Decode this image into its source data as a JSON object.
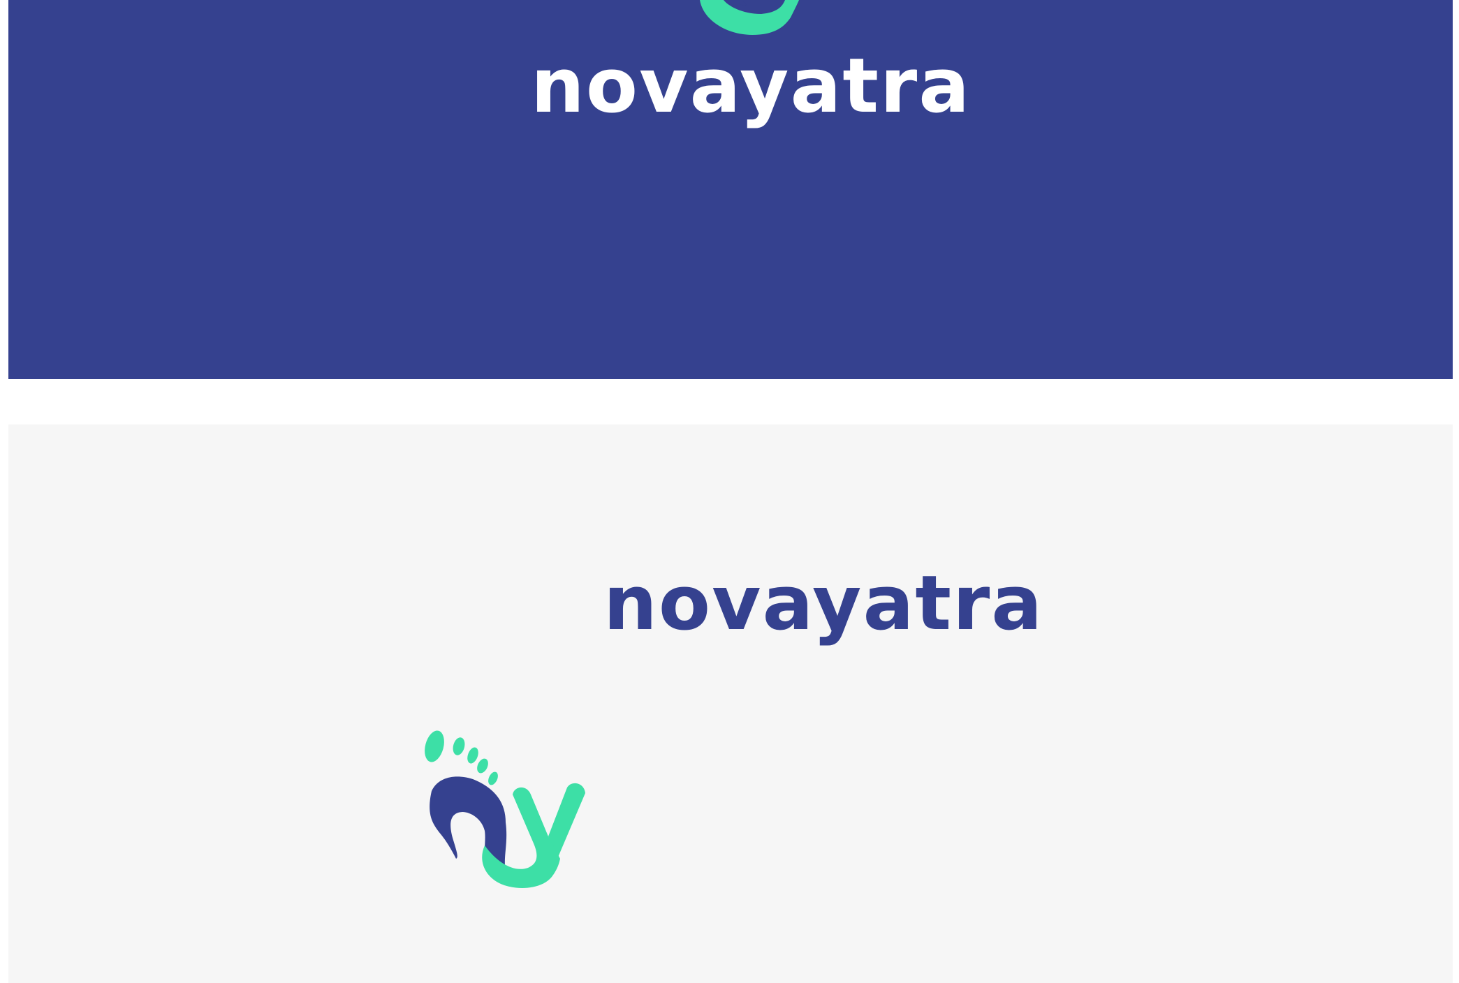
{
  "brand": {
    "name": "novayatra",
    "primary_color": "#35418f",
    "accent_color": "#3ddfa6",
    "light_color": "#ffffff",
    "background_light": "#f6f6f6"
  },
  "top_panel": {
    "background": "#35418f",
    "wordmark_color": "#ffffff",
    "symbol_color": "#3ddfa6"
  },
  "bottom_panel": {
    "background": "#f6f6f6",
    "wordmark_color": "#35418f",
    "symbol_colors": [
      "#35418f",
      "#3ddfa6"
    ],
    "icon": "footprint-y-icon"
  }
}
